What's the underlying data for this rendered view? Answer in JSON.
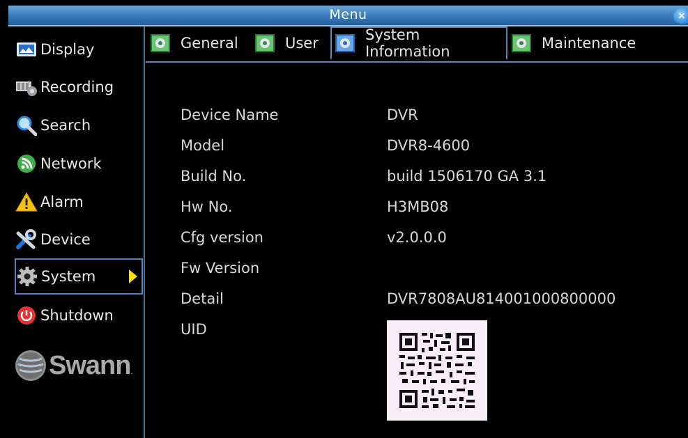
{
  "window": {
    "title": "Menu",
    "close_label": "×"
  },
  "sidebar": {
    "items": [
      {
        "label": "Display",
        "icon": "display-icon"
      },
      {
        "label": "Recording",
        "icon": "recording-icon"
      },
      {
        "label": "Search",
        "icon": "search-icon"
      },
      {
        "label": "Network",
        "icon": "network-icon"
      },
      {
        "label": "Alarm",
        "icon": "alarm-icon"
      },
      {
        "label": "Device",
        "icon": "device-icon"
      },
      {
        "label": "System",
        "icon": "gear-icon",
        "selected": true
      },
      {
        "label": "Shutdown",
        "icon": "power-icon"
      }
    ],
    "brand": "Swann"
  },
  "tabs": [
    {
      "label": "General",
      "icon": "settings-tab-icon"
    },
    {
      "label": "User",
      "icon": "settings-tab-icon"
    },
    {
      "label": "System Information",
      "icon": "settings-tab-icon",
      "active": true
    },
    {
      "label": "Maintenance",
      "icon": "settings-tab-icon"
    }
  ],
  "info": {
    "rows": [
      {
        "label": "Device Name",
        "value": "DVR"
      },
      {
        "label": "Model",
        "value": "DVR8-4600"
      },
      {
        "label": "Build No.",
        "value": "build 1506170 GA 3.1"
      },
      {
        "label": "Hw No.",
        "value": "H3MB08"
      },
      {
        "label": "Cfg version",
        "value": "v2.0.0.0"
      },
      {
        "label": "Fw Version",
        "value": ""
      },
      {
        "label": "Detail",
        "value": "DVR7808AU814001000800000"
      },
      {
        "label": "UID",
        "value": ""
      }
    ],
    "uid_qr_icon": "qr-code-icon"
  },
  "colors": {
    "background": "#000000",
    "titlebar": "#3f7fbf",
    "accent_border": "#5f87b3",
    "arrow": "#ffdf00",
    "text": "#d8d8d8"
  }
}
